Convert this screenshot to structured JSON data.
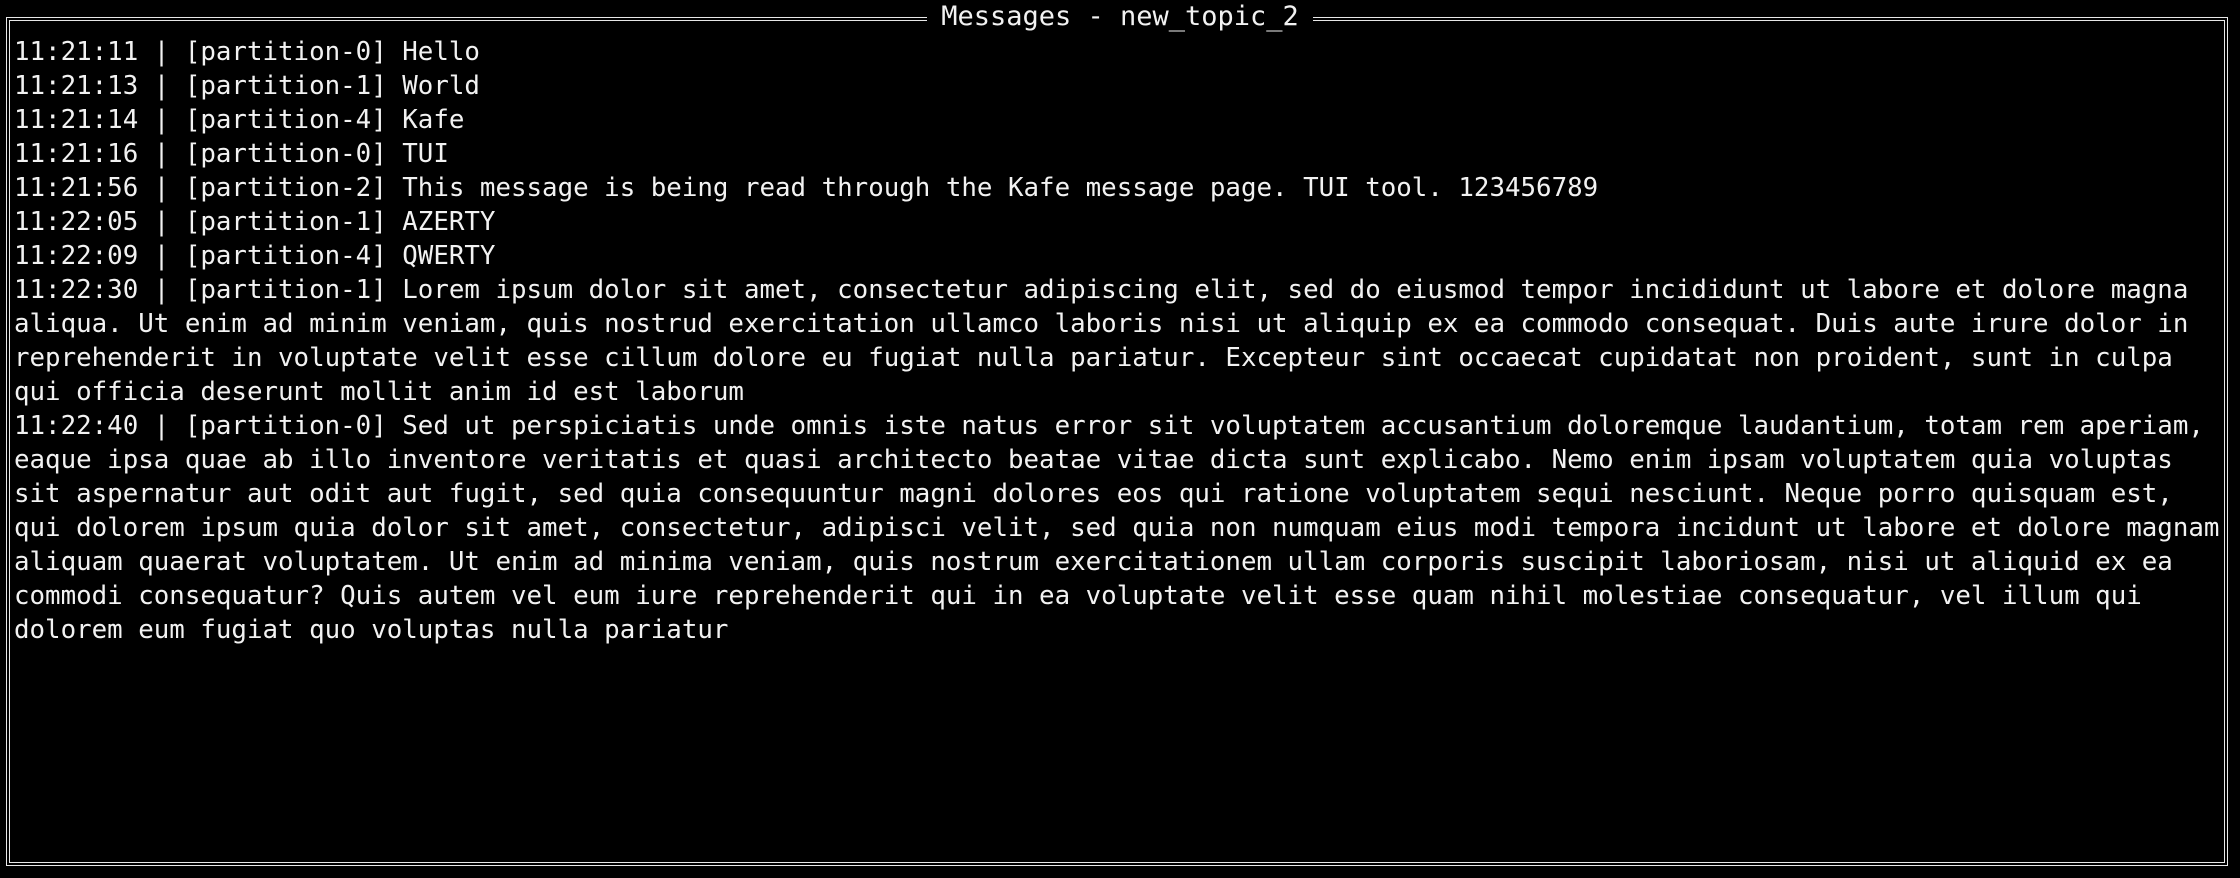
{
  "window": {
    "title": "Messages - new_topic_2"
  },
  "messages": [
    {
      "time": "11:21:11",
      "partition": "[partition-0]",
      "text": "Hello"
    },
    {
      "time": "11:21:13",
      "partition": "[partition-1]",
      "text": "World"
    },
    {
      "time": "11:21:14",
      "partition": "[partition-4]",
      "text": "Kafe"
    },
    {
      "time": "11:21:16",
      "partition": "[partition-0]",
      "text": "TUI"
    },
    {
      "time": "11:21:56",
      "partition": "[partition-2]",
      "text": "This message is being read through the Kafe message page. TUI tool. 123456789"
    },
    {
      "time": "11:22:05",
      "partition": "[partition-1]",
      "text": "AZERTY"
    },
    {
      "time": "11:22:09",
      "partition": "[partition-4]",
      "text": "QWERTY"
    },
    {
      "time": "11:22:30",
      "partition": "[partition-1]",
      "text": "Lorem ipsum dolor sit amet, consectetur adipiscing elit, sed do eiusmod tempor incididunt ut labore et dolore magna aliqua. Ut enim ad minim veniam, quis nostrud exercitation ullamco laboris nisi ut aliquip ex ea commodo consequat. Duis aute irure dolor in reprehenderit in voluptate velit esse cillum dolore eu fugiat nulla pariatur. Excepteur sint occaecat cupidatat non proident, sunt in culpa qui officia deserunt mollit anim id est laborum"
    },
    {
      "time": "11:22:40",
      "partition": "[partition-0]",
      "text": "Sed ut perspiciatis unde omnis iste natus error sit voluptatem accusantium doloremque laudantium, totam rem aperiam, eaque ipsa quae ab illo inventore veritatis et quasi architecto beatae vitae dicta sunt explicabo. Nemo enim ipsam voluptatem quia voluptas sit aspernatur aut odit aut fugit, sed quia consequuntur magni dolores eos qui ratione voluptatem sequi nesciunt. Neque porro quisquam est, qui dolorem ipsum quia dolor sit amet, consectetur, adipisci velit, sed quia non numquam eius modi tempora incidunt ut labore et dolore magnam aliquam quaerat voluptatem. Ut enim ad minima veniam, quis nostrum exercitationem ullam corporis suscipit laboriosam, nisi ut aliquid ex ea commodi consequatur? Quis autem vel eum iure reprehenderit qui in ea voluptate velit esse quam nihil molestiae consequatur, vel illum qui dolorem eum fugiat quo voluptas nulla pariatur"
    }
  ]
}
